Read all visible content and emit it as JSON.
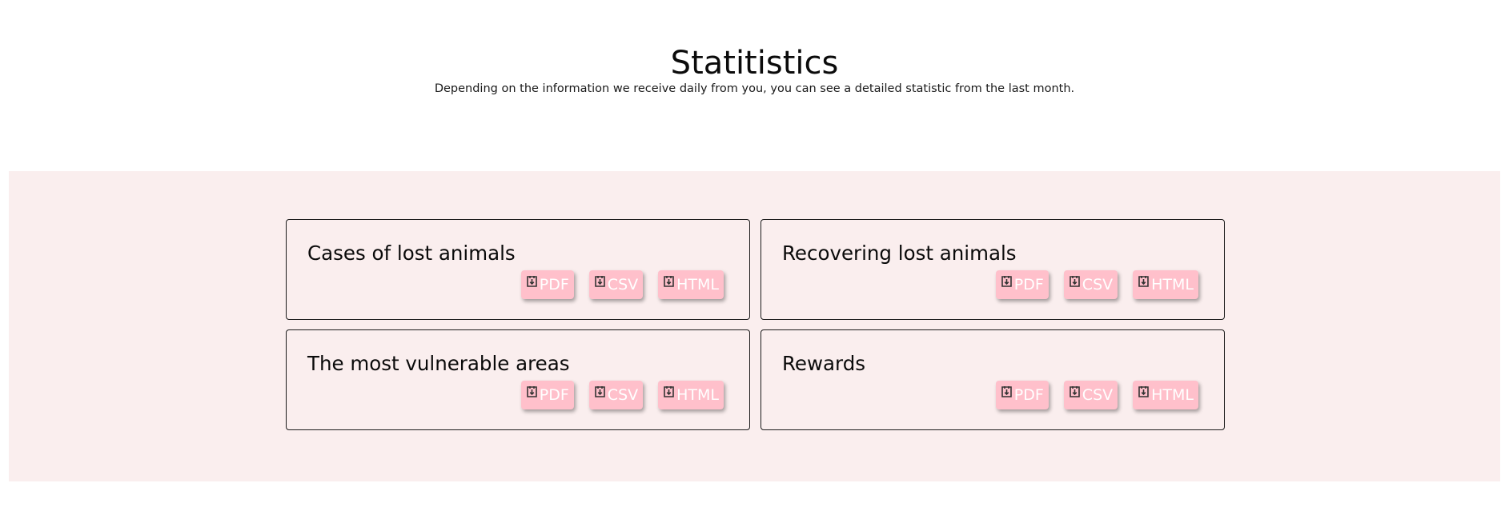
{
  "header": {
    "title": "Statitistics",
    "subtitle": "Depending on the information we receive daily from you, you can see a detailed statistic from the last month."
  },
  "colors": {
    "band_background": "#faeeee",
    "button_background": "#ffc0cb",
    "button_text": "#ffffff",
    "card_border": "#1a1a1a"
  },
  "icons": {
    "download": "download-icon"
  },
  "cards": [
    {
      "title": "Cases of lost animals",
      "buttons": [
        "PDF",
        "CSV",
        "HTML"
      ]
    },
    {
      "title": "Recovering lost animals",
      "buttons": [
        "PDF",
        "CSV",
        "HTML"
      ]
    },
    {
      "title": "The most vulnerable areas",
      "buttons": [
        "PDF",
        "CSV",
        "HTML"
      ]
    },
    {
      "title": "Rewards",
      "buttons": [
        "PDF",
        "CSV",
        "HTML"
      ]
    }
  ]
}
